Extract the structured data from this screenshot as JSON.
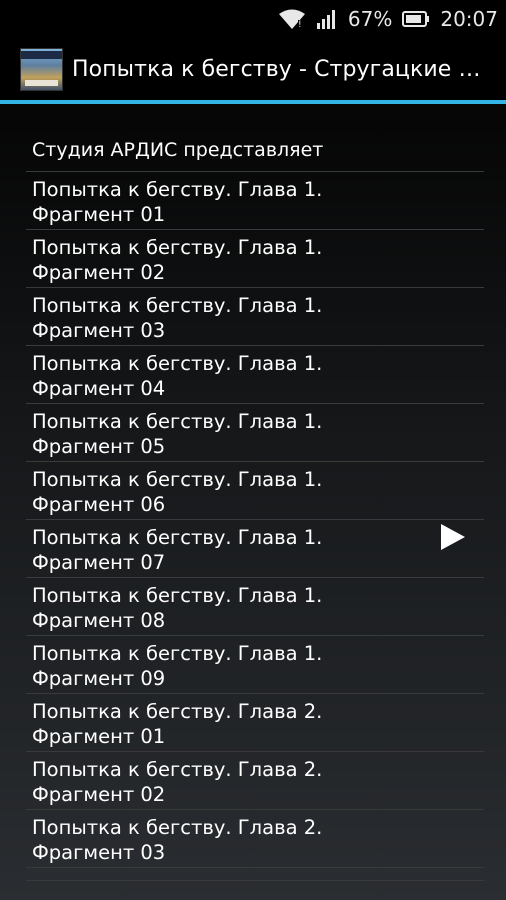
{
  "status_bar": {
    "wifi_icon": "wifi-icon",
    "signal_icon": "signal-icon",
    "battery_percent": "67%",
    "battery_icon": "battery-icon",
    "time": "20:07"
  },
  "action_bar": {
    "app_icon": "book-cover-icon",
    "title": "Попытка к бегству  -  Стругацкие Аркадий и Борис"
  },
  "list": {
    "header": "Студия АРДИС представляет",
    "items": [
      {
        "line1": "Попытка к бегству. Глава 1.",
        "line2": "Фрагмент 01"
      },
      {
        "line1": "Попытка к бегству. Глава 1.",
        "line2": "Фрагмент 02"
      },
      {
        "line1": "Попытка к бегству. Глава 1.",
        "line2": "Фрагмент 03"
      },
      {
        "line1": "Попытка к бегству. Глава 1.",
        "line2": "Фрагмент 04"
      },
      {
        "line1": "Попытка к бегству. Глава 1.",
        "line2": "Фрагмент 05"
      },
      {
        "line1": "Попытка к бегству. Глава 1.",
        "line2": "Фрагмент 06"
      },
      {
        "line1": "Попытка к бегству. Глава 1.",
        "line2": "Фрагмент 07"
      },
      {
        "line1": "Попытка к бегству. Глава 1.",
        "line2": "Фрагмент 08"
      },
      {
        "line1": "Попытка к бегству. Глава 1.",
        "line2": "Фрагмент 09"
      },
      {
        "line1": "Попытка к бегству. Глава 2.",
        "line2": "Фрагмент 01"
      },
      {
        "line1": "Попытка к бегству. Глава 2.",
        "line2": "Фрагмент 02"
      },
      {
        "line1": "Попытка к бегству. Глава 2.",
        "line2": "Фрагмент 03"
      }
    ]
  },
  "player": {
    "play_icon": "play-icon"
  },
  "colors": {
    "accent": "#33b5e5",
    "background": "#000000",
    "text": "#ffffff"
  }
}
